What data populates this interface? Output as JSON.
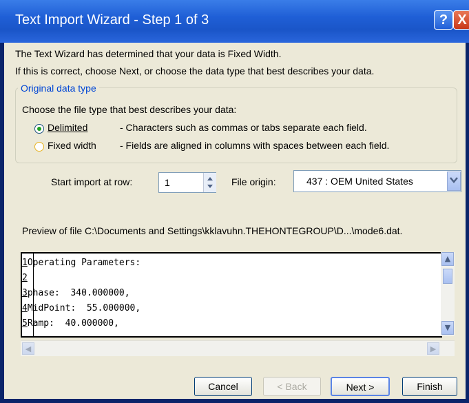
{
  "window": {
    "title": "Text Import Wizard - Step 1 of 3",
    "help_label": "?",
    "close_label": "X"
  },
  "intro": {
    "line1": "The Text Wizard has determined that your data is Fixed Width.",
    "line2": "If this is correct, choose Next, or choose the data type that best describes your data."
  },
  "original_data_type": {
    "group_title": "Original data type",
    "prompt": "Choose the file type that best describes your data:",
    "options": [
      {
        "label": "Delimited",
        "selected": true,
        "description": "- Characters such as commas or tabs separate each field."
      },
      {
        "label": "Fixed width",
        "selected": false,
        "description": "- Fields are aligned in columns with spaces between each field."
      }
    ]
  },
  "import_row": {
    "label": "Start import at row:",
    "value": "1"
  },
  "file_origin": {
    "label": "File origin:",
    "value": "437 : OEM United States"
  },
  "preview": {
    "caption": "Preview of file C:\\Documents and Settings\\kklavuhn.THEHONTEGROUP\\D...\\mode6.dat.",
    "lines": [
      {
        "num": "1",
        "text": "Operating Parameters:"
      },
      {
        "num": "2",
        "text": ""
      },
      {
        "num": "3",
        "text": "phase:  340.000000,"
      },
      {
        "num": "4",
        "text": "MidPoint:  55.000000,"
      },
      {
        "num": "5",
        "text": "Ramp:  40.000000,"
      }
    ]
  },
  "buttons": {
    "cancel": "Cancel",
    "back": "< Back",
    "next": "Next >",
    "finish": "Finish"
  },
  "icons": {
    "radio_selected": "radio-selected-icon",
    "spinner": "spinner-arrows-icon",
    "dropdown": "chevron-down-icon",
    "scroll_up": "scroll-up-icon",
    "scroll_down": "scroll-down-icon"
  }
}
